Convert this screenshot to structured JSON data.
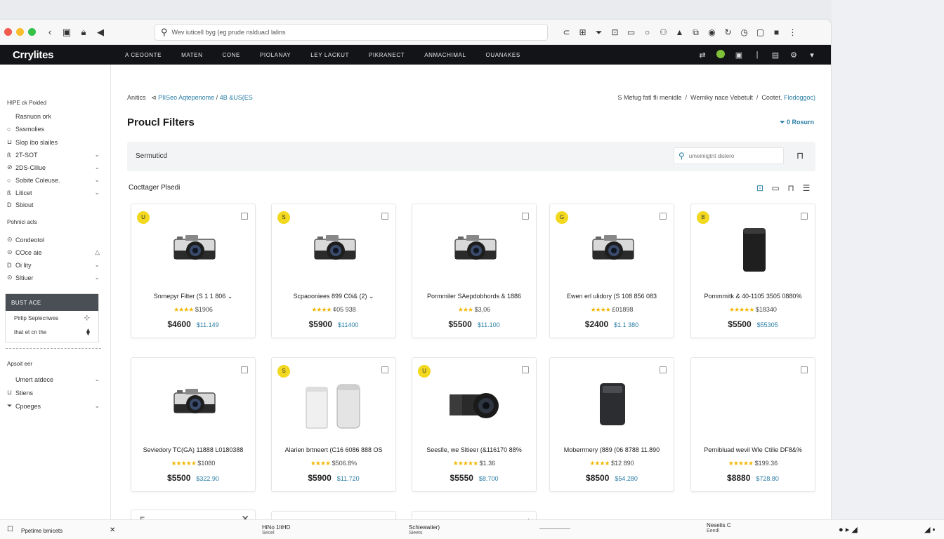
{
  "browser": {
    "url": "Wev iuticell byg (eg prude nslduacl lalins",
    "toolbar_icons": [
      "translate-icon",
      "grid-icon",
      "filter-icon",
      "lock-icon",
      "screen-icon",
      "circle-icon",
      "person-icon",
      "bell-icon",
      "copy-icon",
      "pin-icon",
      "refresh-icon",
      "clock-icon",
      "window-icon",
      "square-icon",
      "more-icon"
    ]
  },
  "topnav": {
    "logo": "Crrylites",
    "links": [
      "A CEOONTE",
      "MATEN",
      "CONE",
      "PIOLANAY",
      "LEY LACKUT",
      "PIKRANECT",
      "ANMACHIMAL",
      "OUANAKES"
    ]
  },
  "sidebar": {
    "section1_title": "HIPE ck Poided",
    "items1": [
      {
        "pre": "",
        "label": "Rasnuon ork",
        "chev": ""
      },
      {
        "pre": "○",
        "label": "Sssmolies",
        "chev": ""
      },
      {
        "pre": "⊔",
        "label": "Slop ibo slailes",
        "chev": ""
      },
      {
        "pre": "ß",
        "label": "2T-SOT",
        "chev": "⌄"
      },
      {
        "pre": "⊘",
        "label": "2DS-Clilue",
        "chev": "⌄"
      },
      {
        "pre": "○",
        "label": "Sobite Coleuse.",
        "chev": "⌄"
      },
      {
        "pre": "ß",
        "label": "Liticet",
        "chev": "⌄"
      },
      {
        "pre": "D",
        "label": "Sbiout",
        "chev": ""
      }
    ],
    "section2_title": "Pohnici acls",
    "items2": [
      {
        "pre": "⊙",
        "label": "Condeotol",
        "chev": ""
      },
      {
        "pre": "⊙",
        "label": "COce aie",
        "chev": "△"
      },
      {
        "pre": "D",
        "label": "Oi lity",
        "chev": "⌄"
      },
      {
        "pre": "⊙",
        "label": "Sltiuer",
        "chev": "⌄"
      }
    ],
    "box": {
      "title": "BUST ACE",
      "rows": [
        {
          "label": "Pirlip Seplecnwes",
          "icon": "⊹"
        },
        {
          "label": "that et cn the",
          "icon": "⧫"
        }
      ]
    },
    "section3_title": "Apsoit eer",
    "items3": [
      {
        "pre": "",
        "label": "Umert atdece",
        "chev": "⌄"
      },
      {
        "pre": "⊔",
        "label": "Stiens",
        "chev": ""
      },
      {
        "pre": "⏷",
        "label": "Cpoeges",
        "chev": "⌄"
      }
    ]
  },
  "main": {
    "breadcrumb": {
      "a": "Anitics",
      "b": "PIISeo Aqtepenome",
      "sep": "/",
      "c": "4B &US(ES"
    },
    "breadcrumb_right": {
      "a": "S Mefug fatl fli menidle",
      "b": "Wemiky nace Vebetult",
      "c": "Cootet.",
      "d": "Flodoggoc)"
    },
    "title": "Proucl Filters",
    "return_link": "0 Rosurn",
    "filter_label": "Sermuticd",
    "search_placeholder": "umeiniigtnt dislero",
    "category_title": "Cocttager Plsedi",
    "products": [
      {
        "name": "Snmepyr Filter (S 1 1 806  ⌄",
        "stars": "★★★★",
        "rating": "$1906",
        "price": "$4600",
        "alt_price": "$11.149",
        "badge": "U",
        "image": "camera-silver"
      },
      {
        "name": "Scpaooniees 899 C0i& (2)  ⌄",
        "stars": "★★★★",
        "rating": "¢05 938",
        "price": "$5900",
        "alt_price": "$11400",
        "badge": "S",
        "image": "camera-silver"
      },
      {
        "name": "Pormmiler SAepdobhords & 1886",
        "stars": "★★★",
        "rating": "$3,06",
        "price": "$5500",
        "alt_price": "$11.100",
        "badge": "",
        "image": "camera-silver"
      },
      {
        "name": "Ewen erl ulidory (S 108 856 083",
        "stars": "★★★★",
        "rating": "£01898",
        "price": "$2400",
        "alt_price": "$1.1 380",
        "badge": "G",
        "image": "camera-silver"
      },
      {
        "name": "Pommmitk & 40-1105 3505 0880%",
        "stars": "★★★★★",
        "rating": "$18340",
        "price": "$5500",
        "alt_price": "$55305",
        "badge": "B",
        "image": "speaker"
      },
      {
        "name": "Seviedory TC(GA) 11888 L0180388",
        "stars": "★★★★★",
        "rating": "$1080",
        "price": "$5500",
        "alt_price": "$322.90",
        "badge": "",
        "image": "camera-silver"
      },
      {
        "name": "Alarien brtneert (C16 6086 888 OS",
        "stars": "★★★★",
        "rating": "$506.8%",
        "price": "$5900",
        "alt_price": "$11.720",
        "badge": "S",
        "image": "canisters"
      },
      {
        "name": "Seeslle, we Sltieer (&116170 88%",
        "stars": "★★★★★",
        "rating": "$1.36",
        "price": "$5550",
        "alt_price": "$8.700",
        "badge": "U",
        "image": "camera-black"
      },
      {
        "name": "Moberrmery (889 (06 8788 11.890",
        "stars": "★★★★",
        "rating": "$12 890",
        "price": "$8500",
        "alt_price": "$54.280",
        "badge": "",
        "image": "box-dark"
      },
      {
        "name": "Pernibluad wevil Wle Ctilie DF8&%",
        "stars": "★★★★★",
        "rating": "$199.36",
        "price": "$8880",
        "alt_price": "$728.80",
        "badge": "",
        "image": "none"
      }
    ],
    "partial_cards": [
      {
        "num": "5",
        "action": "✕"
      },
      {
        "num": "",
        "action": ""
      },
      {
        "num": "",
        "action": "+"
      }
    ]
  },
  "bottombar": {
    "left_label": "Ppetime bmicets",
    "col2_title": "HiNo 1ItHD",
    "col2_sub": "Secel",
    "col3_title": "Schiewatier)",
    "col3_sub": "Sieets",
    "col4_title": "Nesetis C",
    "col4_sub": "Eeedl"
  },
  "colors": {
    "accent": "#2a7ea5",
    "nav_bg": "#121417",
    "badge": "#f2d81f",
    "star": "#f2b705"
  }
}
